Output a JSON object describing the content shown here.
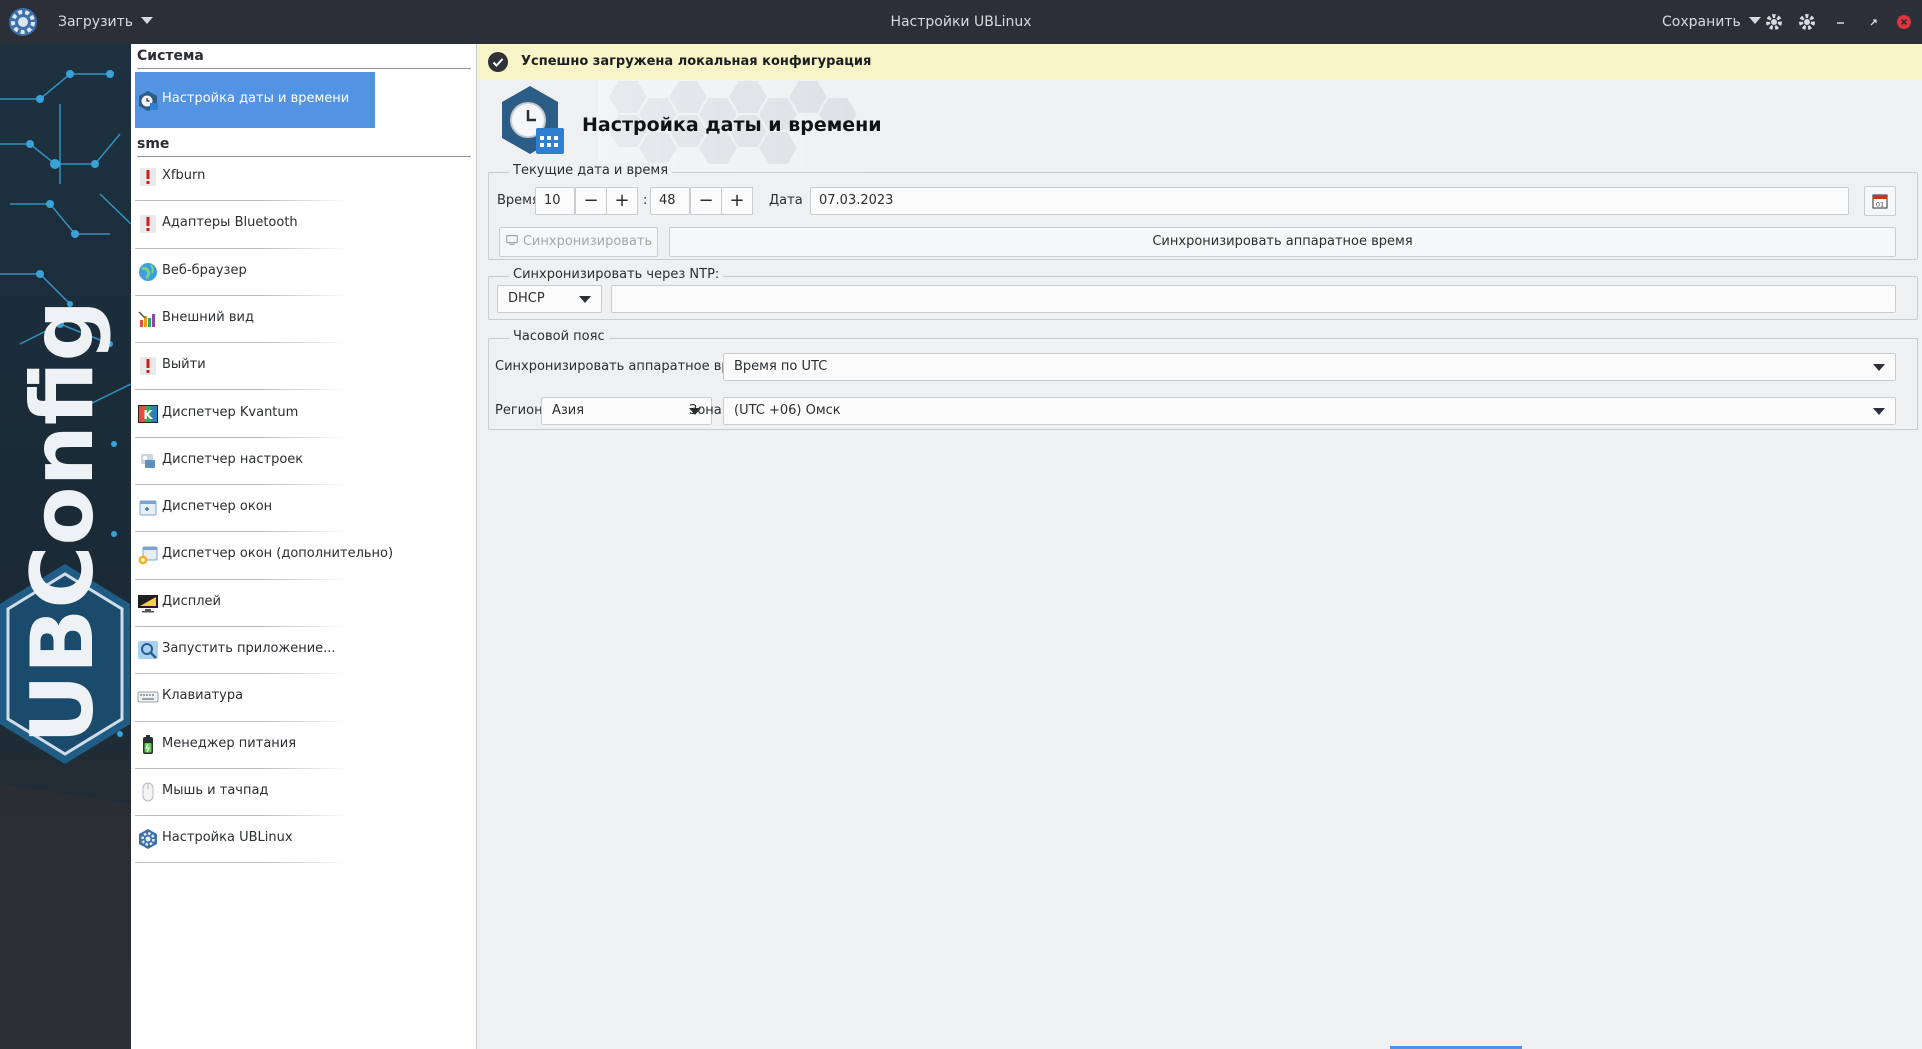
{
  "window": {
    "title": "Настройки UBLinux",
    "load_menu": "Загрузить",
    "save_menu": "Сохранить"
  },
  "banner": {
    "brand_text": "UBConfig"
  },
  "sidebar": {
    "sections": [
      {
        "title": "Система"
      },
      {
        "title": "sme"
      }
    ],
    "active_item": "Настройка даты и времени",
    "items": [
      {
        "label": "Xfburn",
        "icon": "warning-icon"
      },
      {
        "label": "Адаптеры Bluetooth",
        "icon": "warning-icon"
      },
      {
        "label": "Веб-браузер",
        "icon": "globe-icon"
      },
      {
        "label": "Внешний вид",
        "icon": "appearance-icon"
      },
      {
        "label": "Выйти",
        "icon": "warning-icon"
      },
      {
        "label": "Диспетчер Kvantum",
        "icon": "kvantum-icon"
      },
      {
        "label": "Диспетчер настроек",
        "icon": "settings-manager-icon"
      },
      {
        "label": "Диспетчер окон",
        "icon": "window-manager-icon"
      },
      {
        "label": "Диспетчер окон (дополнительно)",
        "icon": "window-manager-tweaks-icon"
      },
      {
        "label": "Дисплей",
        "icon": "display-icon"
      },
      {
        "label": "Запустить приложение...",
        "icon": "run-app-icon"
      },
      {
        "label": "Клавиатура",
        "icon": "keyboard-icon"
      },
      {
        "label": "Менеджер питания",
        "icon": "battery-icon"
      },
      {
        "label": "Мышь и тачпад",
        "icon": "mouse-icon"
      },
      {
        "label": "Настройка UBLinux",
        "icon": "ublinux-gear-icon"
      }
    ]
  },
  "infobar": {
    "message": "Успешно загружена локальная конфигурация"
  },
  "header": {
    "title": "Настройка даты и времени"
  },
  "datetime": {
    "group_title": "Текущие дата и время",
    "time_label": "Время",
    "hours": "10",
    "separator": ":",
    "minutes": "48",
    "minus": "−",
    "plus": "+",
    "date_label": "Дата",
    "date_value": "07.03.2023",
    "sync_button": "Синхронизировать",
    "hw_sync_button": "Синхронизировать аппаратное время"
  },
  "ntp": {
    "group_title": "Синхронизировать через NTP:",
    "mode": "DHCP",
    "server_value": ""
  },
  "timezone": {
    "group_title": "Часовой пояс",
    "hw_label": "Синхронизировать аппаратное время:",
    "hw_value": "Время по UTC",
    "region_label": "Регион",
    "region_value": "Азия",
    "zone_label": "Зона",
    "zone_value": "(UTC +06) Омск"
  },
  "colors": {
    "titlebar": "#2a2f38",
    "accent": "#5294e2",
    "infobar": "#f7f4c8",
    "close": "#e0353c"
  }
}
